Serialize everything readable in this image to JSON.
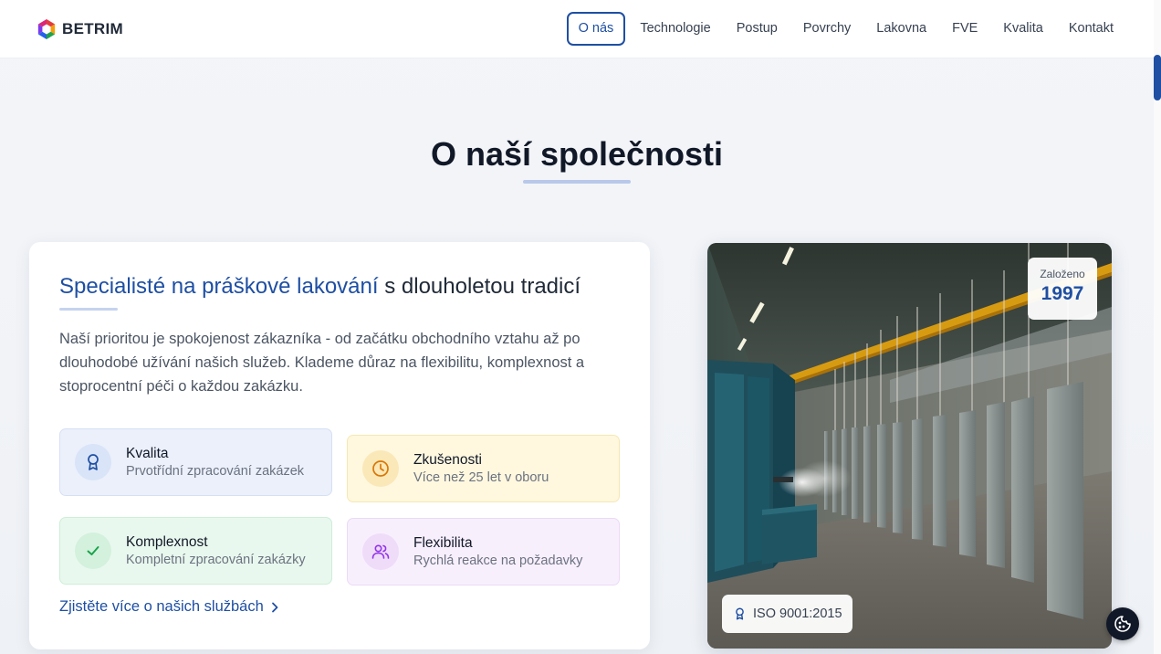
{
  "header": {
    "brand": "BETRIM",
    "menu": [
      {
        "label": "O nás",
        "active": true
      },
      {
        "label": "Technologie"
      },
      {
        "label": "Postup"
      },
      {
        "label": "Povrchy"
      },
      {
        "label": "Lakovna"
      },
      {
        "label": "FVE"
      },
      {
        "label": "Kvalita"
      },
      {
        "label": "Kontakt"
      }
    ]
  },
  "section": {
    "title": "O naší společnosti"
  },
  "card": {
    "heading_highlight": "Specialisté na práškové lakování",
    "heading_rest": "s dlouholetou tradicí",
    "paragraph": "Naší prioritou je spokojenost zákazníka - od začátku obchodního vztahu až po dlouhodobé užívání našich služeb. Klademe důraz na flexibilitu, komplexnost a stoprocentní péči o každou zakázku.",
    "features": [
      {
        "title": "Kvalita",
        "subtitle": "Prvotřídní zpracování zakázek",
        "icon": "award-icon",
        "color": "#1e4fa3"
      },
      {
        "title": "Zkušenosti",
        "subtitle": "Více než 25 let v oboru",
        "icon": "clock-icon",
        "color": "#d97706"
      },
      {
        "title": "Komplexnost",
        "subtitle": "Kompletní zpracování zakázky",
        "icon": "check-icon",
        "color": "#16a34a"
      },
      {
        "title": "Flexibilita",
        "subtitle": "Rychlá reakce na požadavky",
        "icon": "users-icon",
        "color": "#9333ea"
      }
    ],
    "link": "Zjistěte více o našich službách"
  },
  "photo": {
    "founded_label": "Založeno",
    "founded_year": "1997",
    "iso_label": "ISO 9001:2015"
  },
  "colors": {
    "accent": "#1e4fa3",
    "text_dark": "#111827"
  }
}
